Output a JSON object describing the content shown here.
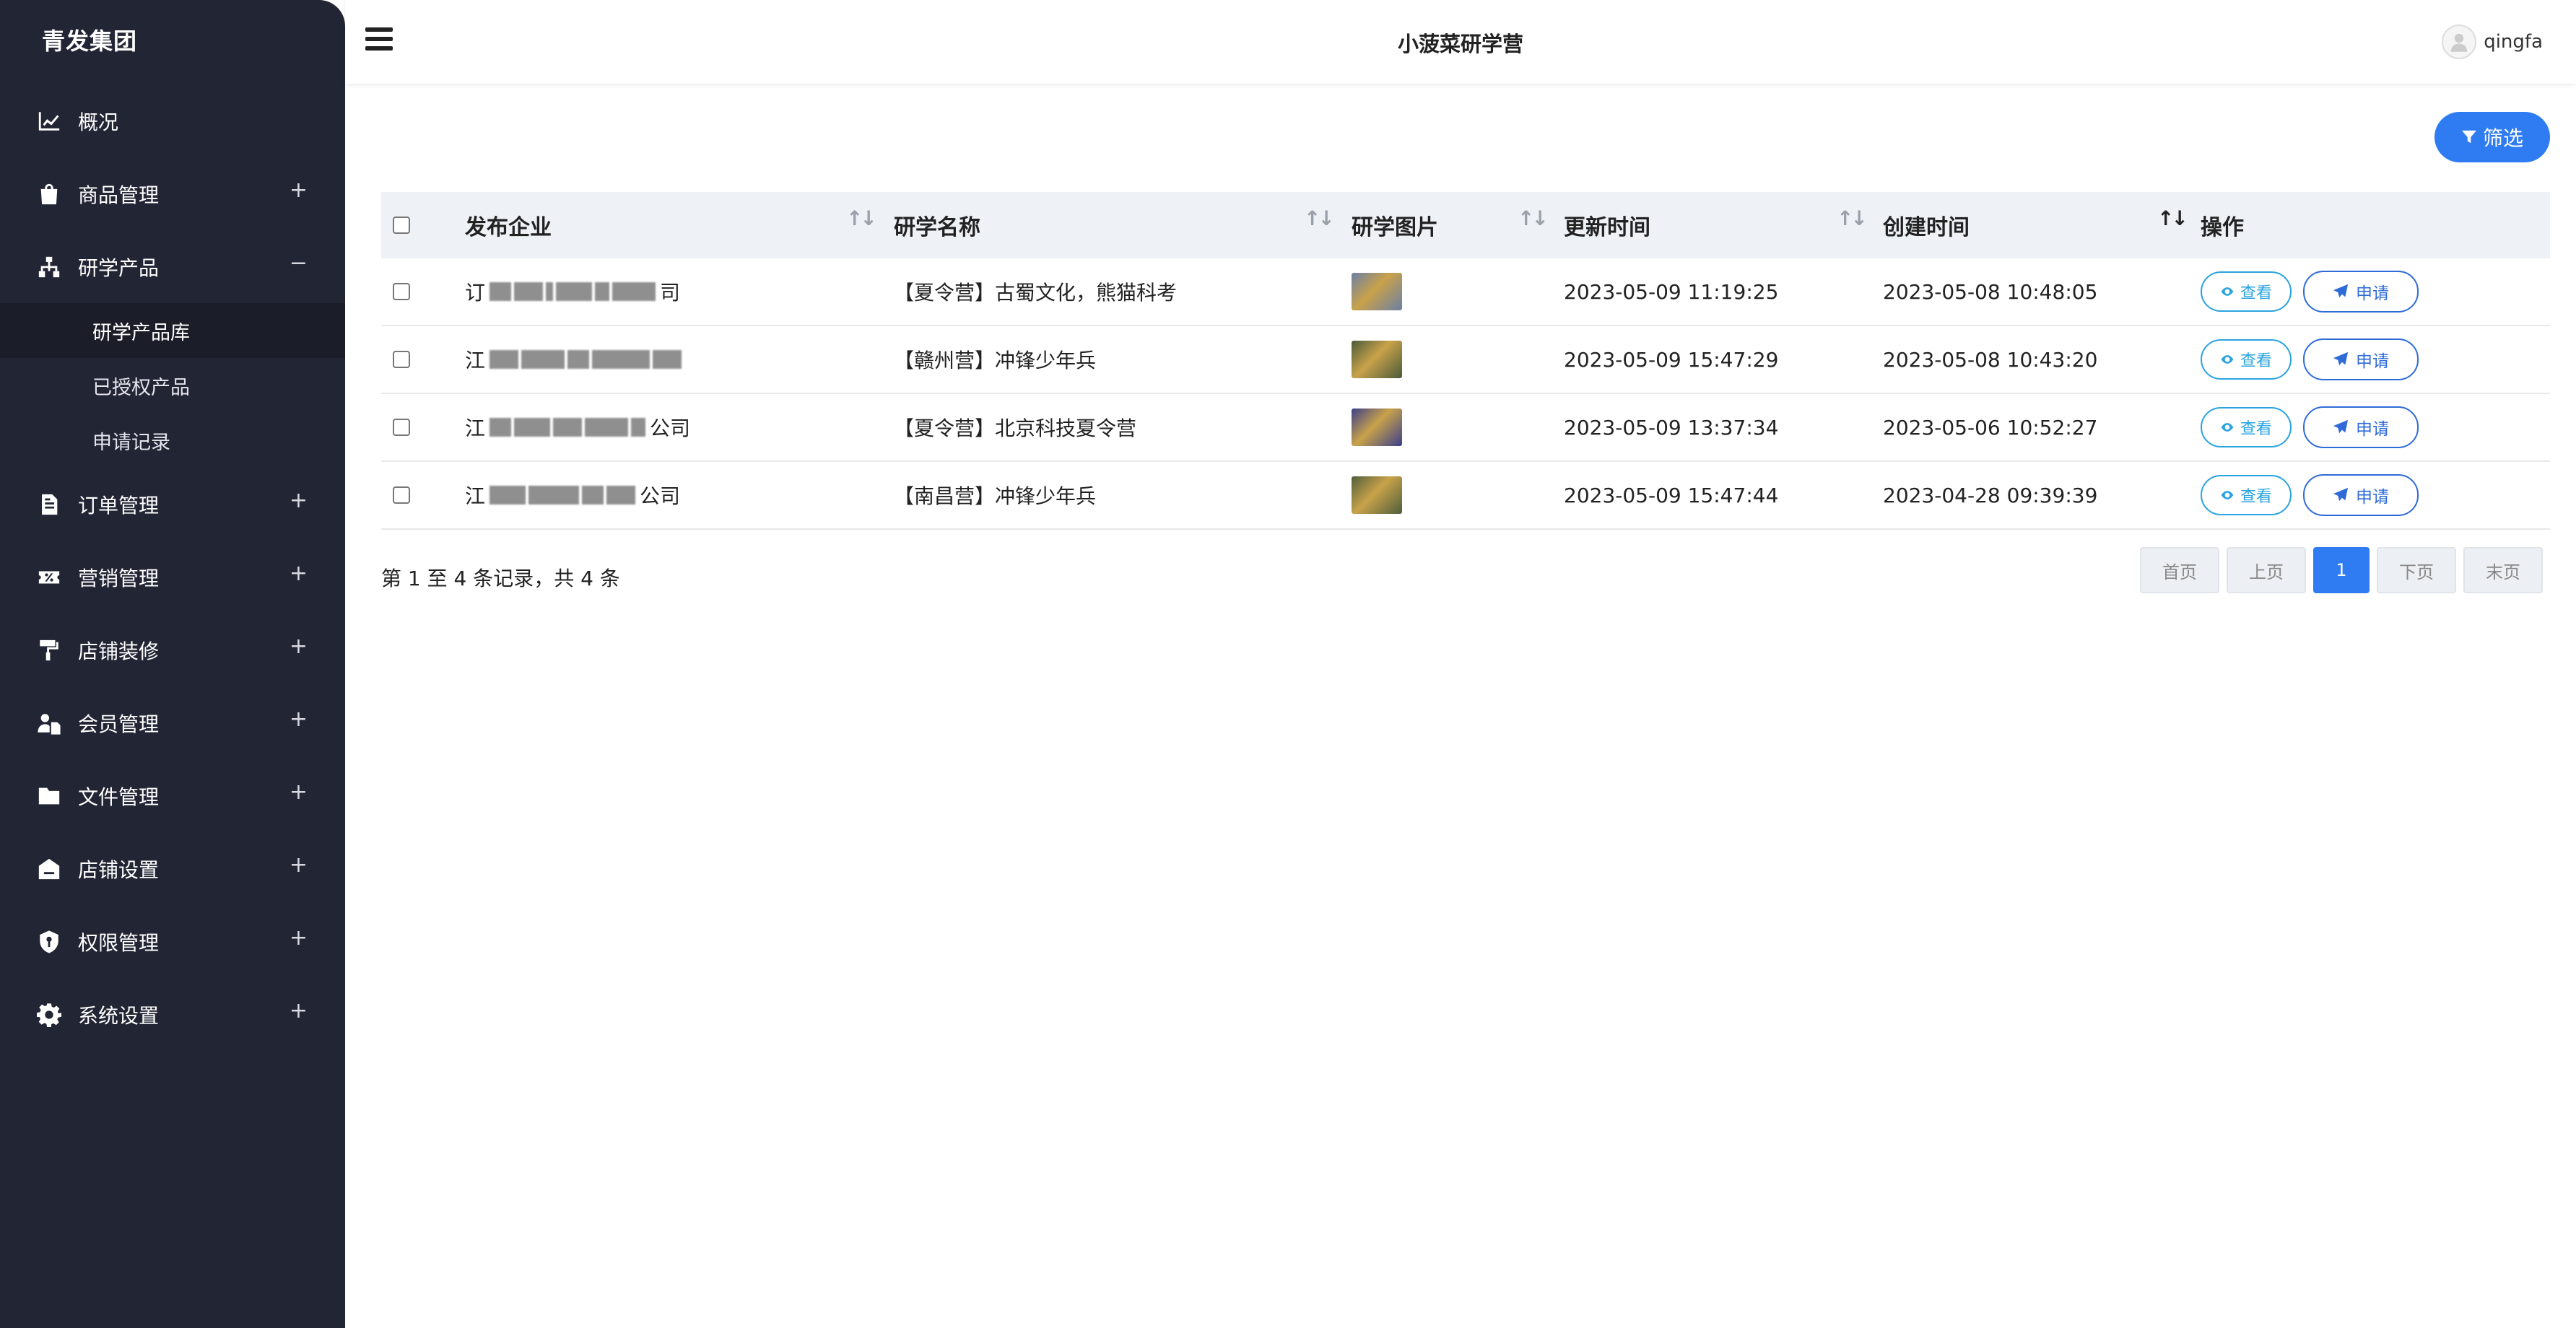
{
  "sidebar": {
    "brand": "青发集团",
    "items": [
      {
        "label": "概况",
        "icon": "chart-line-icon",
        "toggle": ""
      },
      {
        "label": "商品管理",
        "icon": "shopping-bag-icon",
        "toggle": "+"
      },
      {
        "label": "研学产品",
        "icon": "sitemap-icon",
        "toggle": "−"
      },
      {
        "label": "订单管理",
        "icon": "file-text-icon",
        "toggle": "+"
      },
      {
        "label": "营销管理",
        "icon": "percent-ticket-icon",
        "toggle": "+"
      },
      {
        "label": "店铺装修",
        "icon": "paint-roller-icon",
        "toggle": "+"
      },
      {
        "label": "会员管理",
        "icon": "user-file-icon",
        "toggle": "+"
      },
      {
        "label": "文件管理",
        "icon": "folder-icon",
        "toggle": "+"
      },
      {
        "label": "店铺设置",
        "icon": "store-icon",
        "toggle": "+"
      },
      {
        "label": "权限管理",
        "icon": "shield-key-icon",
        "toggle": "+"
      },
      {
        "label": "系统设置",
        "icon": "gear-icon",
        "toggle": "+"
      }
    ],
    "subitems": [
      {
        "label": "研学产品库",
        "active": true
      },
      {
        "label": "已授权产品",
        "active": false
      },
      {
        "label": "申请记录",
        "active": false
      }
    ]
  },
  "header": {
    "title": "小菠菜研学营",
    "username": "qingfa"
  },
  "toolbar": {
    "filter_label": "筛选"
  },
  "table": {
    "columns": [
      "发布企业",
      "研学名称",
      "研学图片",
      "更新时间",
      "创建时间",
      "操作"
    ],
    "rows": [
      {
        "company_prefix": "订",
        "company_suffix": "司",
        "name": "【夏令营】古蜀文化，熊猫科考",
        "updated": "2023-05-09 11:19:25",
        "created": "2023-05-08 10:48:05",
        "thumb_color": "#6b7fa6"
      },
      {
        "company_prefix": "江",
        "company_suffix": "",
        "name": "【赣州营】冲锋少年兵",
        "updated": "2023-05-09 15:47:29",
        "created": "2023-05-08 10:43:20",
        "thumb_color": "#4a5a3a"
      },
      {
        "company_prefix": "江",
        "company_suffix": "公司",
        "name": "【夏令营】北京科技夏令营",
        "updated": "2023-05-09 13:37:34",
        "created": "2023-05-06 10:52:27",
        "thumb_color": "#3b3f8a"
      },
      {
        "company_prefix": "江",
        "company_suffix": "公司",
        "name": "【南昌营】冲锋少年兵",
        "updated": "2023-05-09 15:47:44",
        "created": "2023-04-28 09:39:39",
        "thumb_color": "#4f5e3c"
      }
    ],
    "view_label": "查看",
    "apply_label": "申请"
  },
  "footer": {
    "summary": "第 1 至 4 条记录，共 4 条",
    "pager": [
      "首页",
      "上页",
      "1",
      "下页",
      "末页"
    ]
  }
}
